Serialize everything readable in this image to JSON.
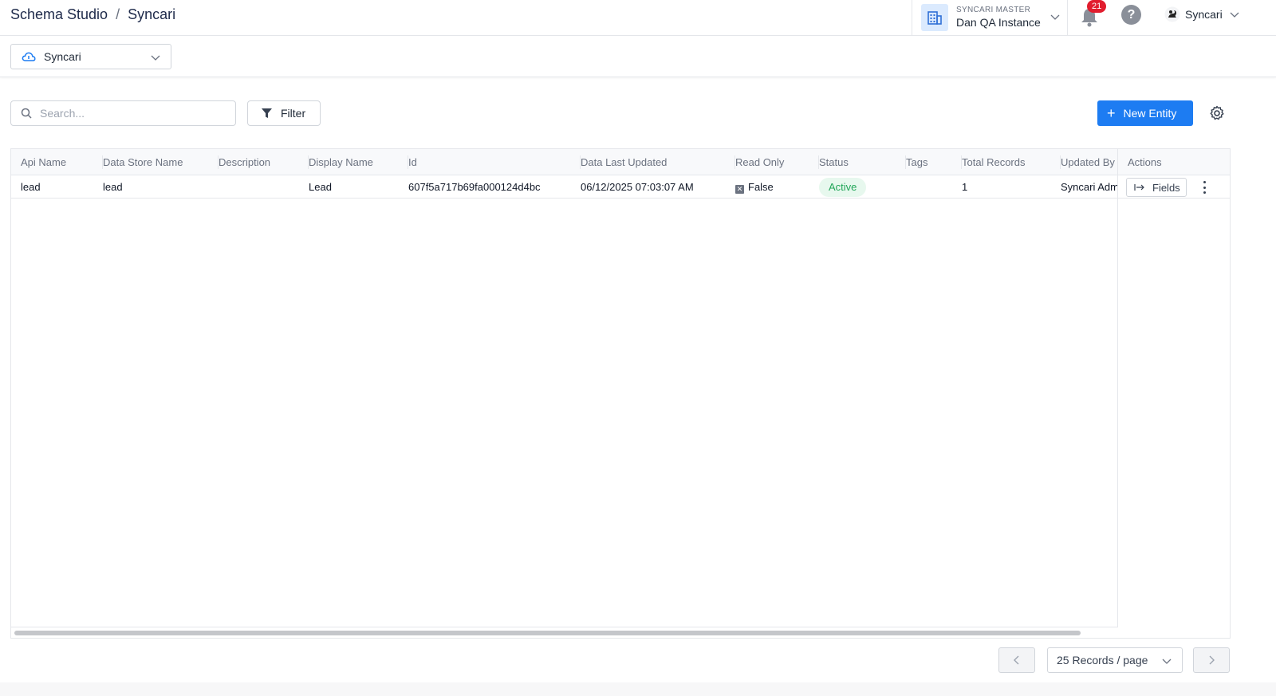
{
  "header": {
    "breadcrumb": [
      "Schema Studio",
      "Syncari"
    ],
    "breadcrumb_separator": "/",
    "instance_label": "SYNCARI MASTER",
    "instance_name": "Dan QA Instance",
    "notification_count": "21",
    "help_symbol": "?",
    "user_name": "Syncari"
  },
  "data_store_select": {
    "value": "Syncari",
    "icon": "cloud-icon"
  },
  "toolbar": {
    "search_placeholder": "Search...",
    "filter_label": "Filter",
    "new_entity_label": "New Entity",
    "new_entity_plus": "+"
  },
  "table": {
    "columns": [
      "Api Name",
      "Data Store Name",
      "Description",
      "Display Name",
      "Id",
      "Data Last Updated",
      "Read Only",
      "Status",
      "Tags",
      "Total Records",
      "Updated By",
      "Actions"
    ],
    "rows": [
      {
        "api_name": "lead",
        "data_store_name": "lead",
        "description": "",
        "display_name": "Lead",
        "id": "607f5a717b69fa000124d4bc",
        "data_last_updated": "06/12/2025 07:03:07 AM",
        "read_only": "False",
        "read_only_mark": "✕",
        "status": "Active",
        "tags": "",
        "total_records": "1",
        "updated_by": "Syncari Admin",
        "action_label": "Fields"
      }
    ]
  },
  "pagination": {
    "page_size_label": "25 Records / page"
  },
  "colors": {
    "accent": "#1d7cf2",
    "status_active_text": "#22a659",
    "status_active_bg": "#e7f8ee",
    "badge": "#e11d2e"
  }
}
